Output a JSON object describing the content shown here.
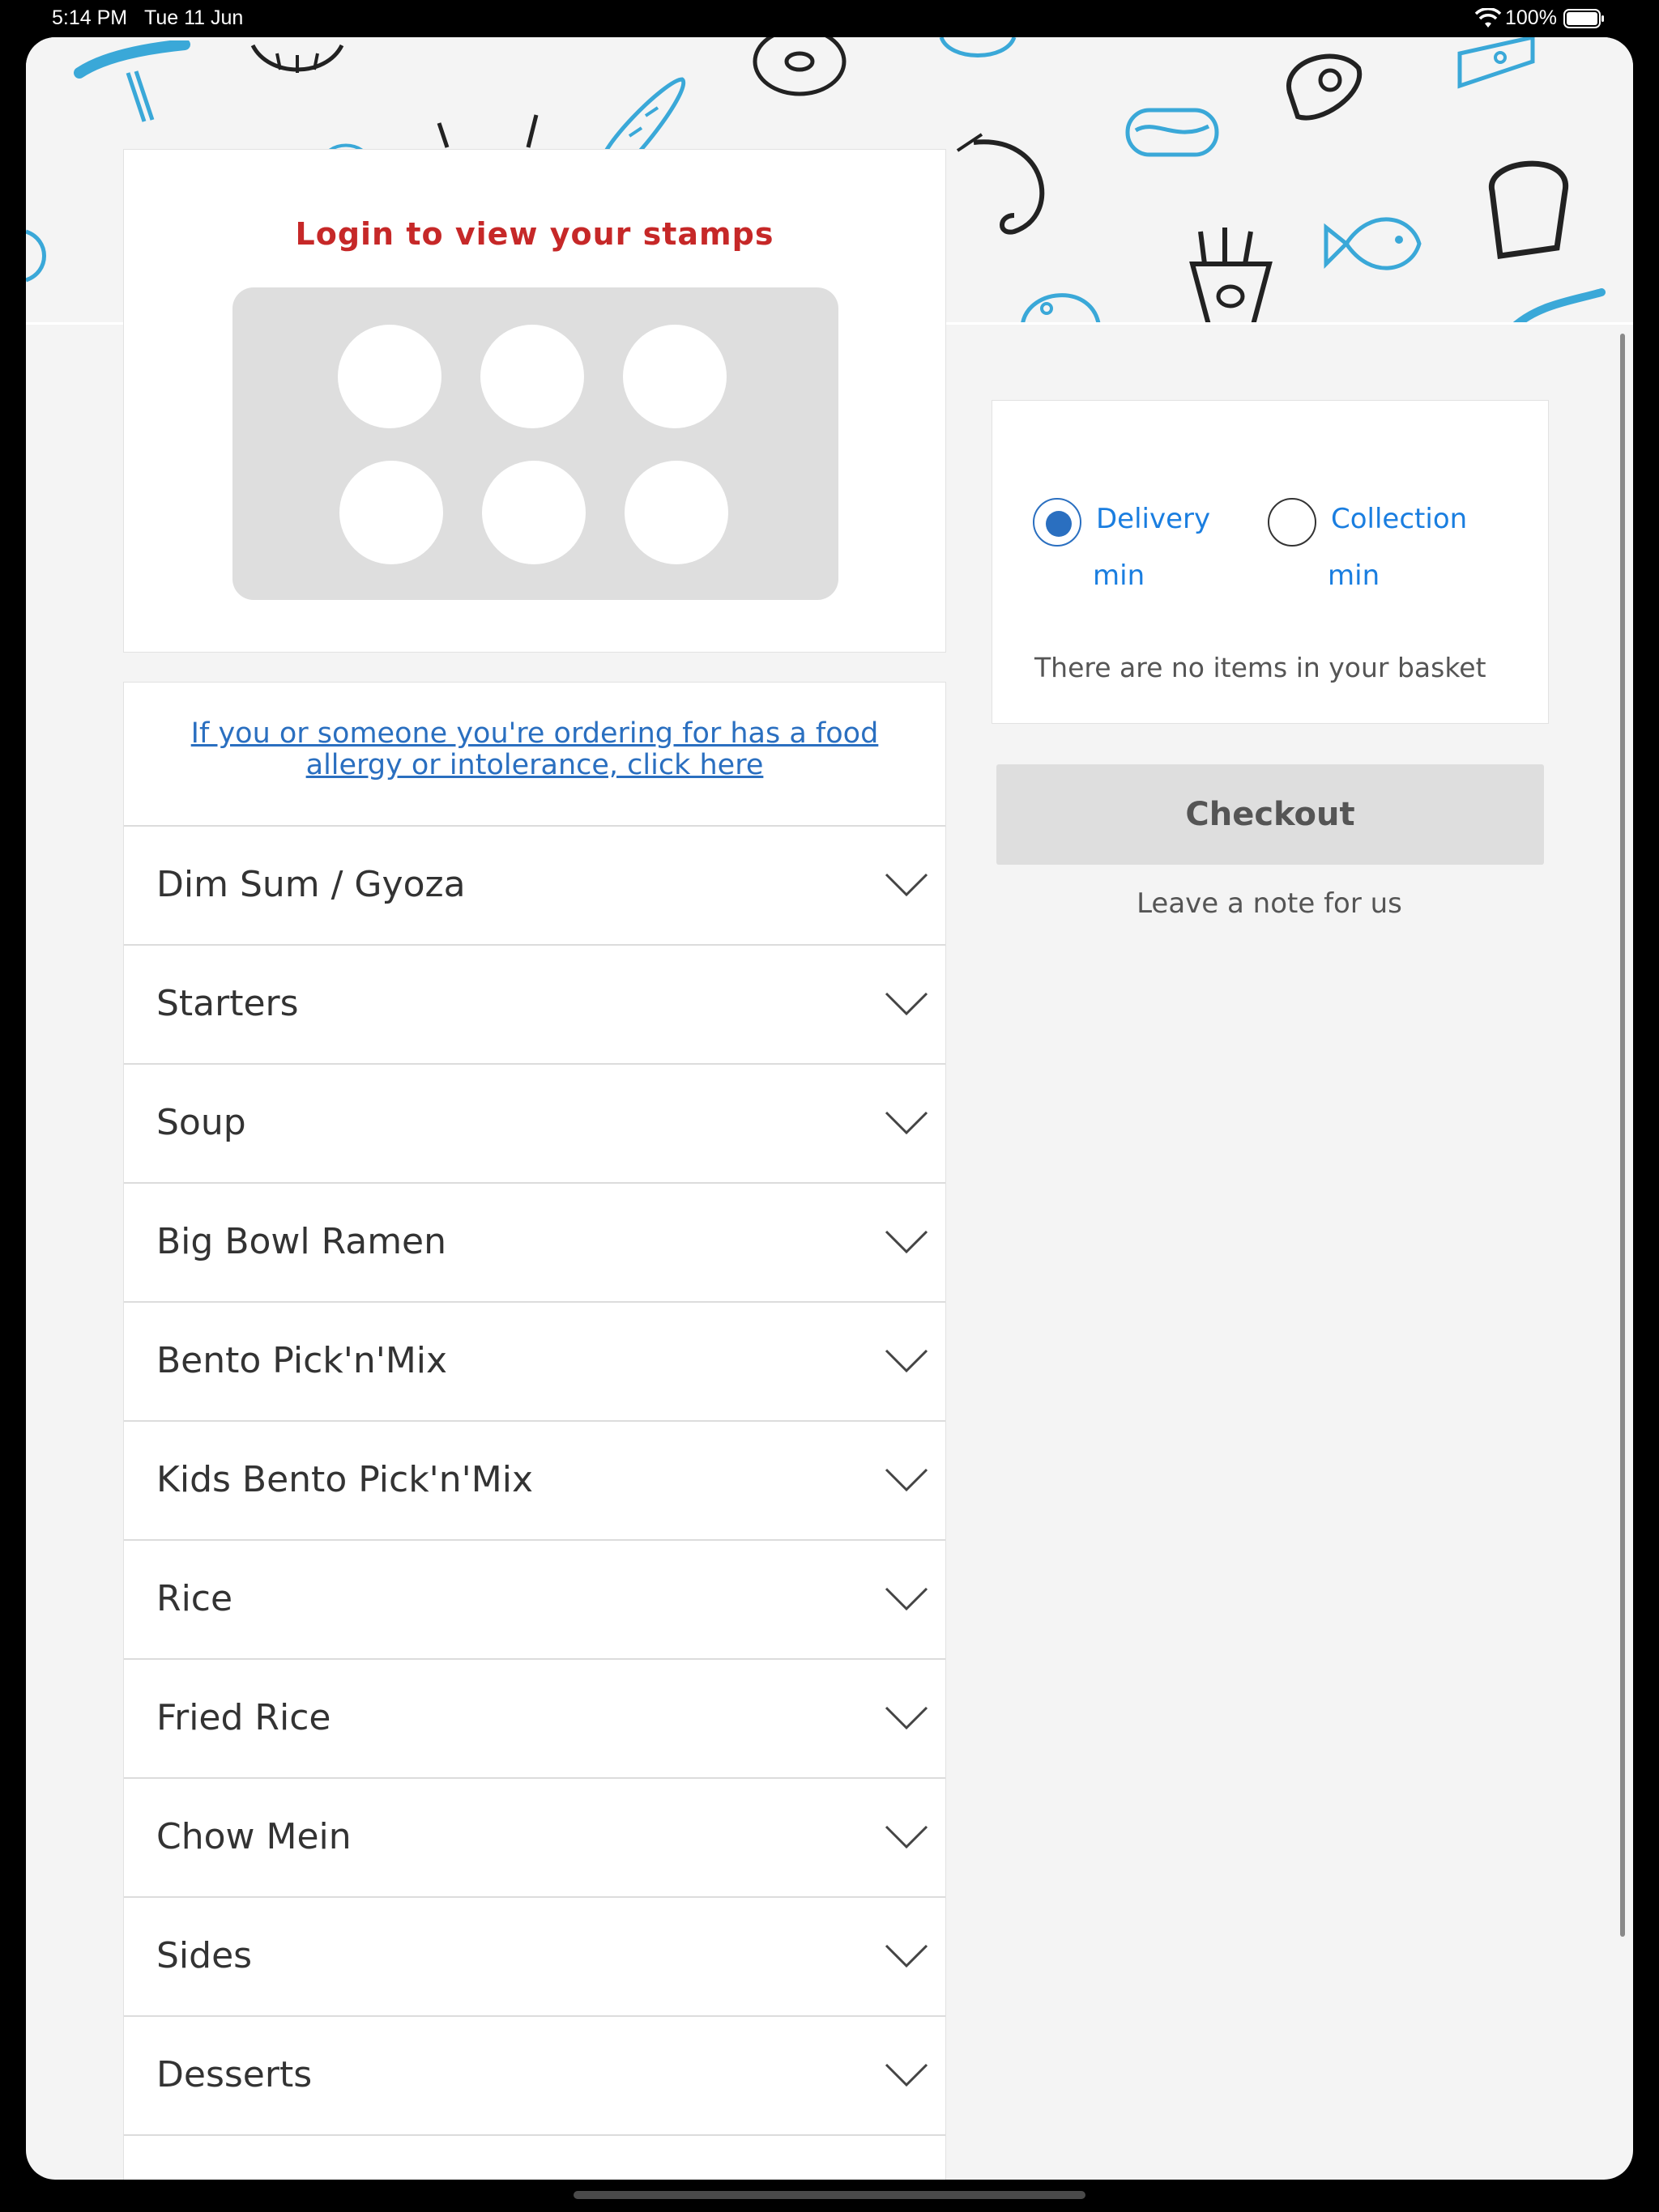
{
  "status_bar": {
    "time": "5:14 PM",
    "date": "Tue 11 Jun",
    "battery_percent": "100%"
  },
  "stamps": {
    "title": "Login to view your stamps",
    "count": 6
  },
  "menu": {
    "allergy_link": "If you or someone you're ordering for has a food allergy or intolerance, click here",
    "categories": [
      {
        "label": "Dim Sum / Gyoza"
      },
      {
        "label": "Starters"
      },
      {
        "label": "Soup"
      },
      {
        "label": "Big Bowl Ramen"
      },
      {
        "label": "Bento Pick'n'Mix"
      },
      {
        "label": "Kids Bento Pick'n'Mix"
      },
      {
        "label": "Rice"
      },
      {
        "label": "Fried Rice"
      },
      {
        "label": "Chow Mein"
      },
      {
        "label": "Sides"
      },
      {
        "label": "Desserts"
      },
      {
        "label": ""
      }
    ]
  },
  "order": {
    "delivery_label": "Delivery",
    "delivery_min": "min",
    "collection_label": "Collection",
    "collection_min": "min",
    "selected": "delivery",
    "basket_empty": "There are no items in your basket",
    "checkout_label": "Checkout",
    "note_link": "Leave a note for us"
  },
  "colors": {
    "accent_blue": "#1a7ee0",
    "link_blue": "#2a6fc0",
    "stamps_red": "#c62828",
    "doodle_blue": "#3aa8d8",
    "doodle_dark": "#222222"
  }
}
